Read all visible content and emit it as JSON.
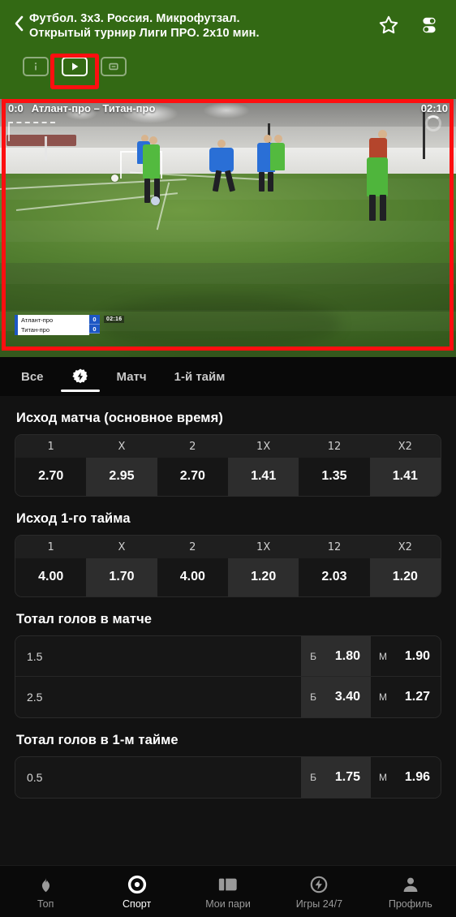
{
  "header": {
    "back_icon": "chevron-left-icon",
    "title_line1": "Футбол. 3x3. Россия. Микрофутзал.",
    "title_line2": "Открытый турнир Лиги ПРО. 2x10 мин.",
    "favorite_icon": "star-icon",
    "settings_icon": "toggles-icon",
    "bg_color": "#336914",
    "mode_tabs": [
      {
        "name": "info-tab",
        "icon": "info-icon",
        "active": false
      },
      {
        "name": "video-tab",
        "icon": "play-icon",
        "active": true
      },
      {
        "name": "scoreboard-tab",
        "icon": "scoreboard-icon",
        "active": false
      }
    ],
    "highlight_color": "#fd0f10"
  },
  "player": {
    "score": "0:0",
    "match_title": "Атлант-про – Титан-про",
    "timer": "02:10",
    "loading_icon": "spinner-icon",
    "broadcast_overlay": {
      "team_home": "Атлант-про",
      "team_away": "Титан-про",
      "score_home": "0",
      "score_away": "0",
      "clock": "02:16"
    }
  },
  "filter_tabs": [
    {
      "name": "tab-all",
      "label": "Все",
      "active": false,
      "icon": null
    },
    {
      "name": "tab-flash",
      "label": "",
      "active": true,
      "icon": "flash-bolt-icon"
    },
    {
      "name": "tab-match",
      "label": "Матч",
      "active": false,
      "icon": null
    },
    {
      "name": "tab-first-half",
      "label": "1-й тайм",
      "active": false,
      "icon": null
    }
  ],
  "markets": [
    {
      "title": "Исход матча (основное время)",
      "type": "outcome",
      "columns": [
        "1",
        "X",
        "2",
        "1X",
        "12",
        "X2"
      ],
      "odds": [
        "2.70",
        "2.95",
        "2.70",
        "1.41",
        "1.35",
        "1.41"
      ]
    },
    {
      "title": "Исход 1-го тайма",
      "type": "outcome",
      "columns": [
        "1",
        "X",
        "2",
        "1X",
        "12",
        "X2"
      ],
      "odds": [
        "4.00",
        "1.70",
        "4.00",
        "1.20",
        "2.03",
        "1.20"
      ]
    },
    {
      "title": "Тотал голов в матче",
      "type": "total",
      "rows": [
        {
          "line": "1.5",
          "over_key": "Б",
          "over": "1.80",
          "under_key": "М",
          "under": "1.90"
        },
        {
          "line": "2.5",
          "over_key": "Б",
          "over": "3.40",
          "under_key": "М",
          "under": "1.27"
        }
      ]
    },
    {
      "title": "Тотал голов в 1-м тайме",
      "type": "total",
      "rows": [
        {
          "line": "0.5",
          "over_key": "Б",
          "over": "1.75",
          "under_key": "М",
          "under": "1.96"
        }
      ]
    }
  ],
  "bottom_nav": [
    {
      "name": "nav-top",
      "label": "Топ",
      "icon": "flame-icon",
      "active": false
    },
    {
      "name": "nav-sport",
      "label": "Спорт",
      "icon": "target-icon",
      "active": true
    },
    {
      "name": "nav-my-bets",
      "label": "Мои пари",
      "icon": "ticket-icon",
      "active": false
    },
    {
      "name": "nav-games",
      "label": "Игры 24/7",
      "icon": "bolt-circle-icon",
      "active": false
    },
    {
      "name": "nav-profile",
      "label": "Профиль",
      "icon": "person-icon",
      "active": false
    }
  ]
}
